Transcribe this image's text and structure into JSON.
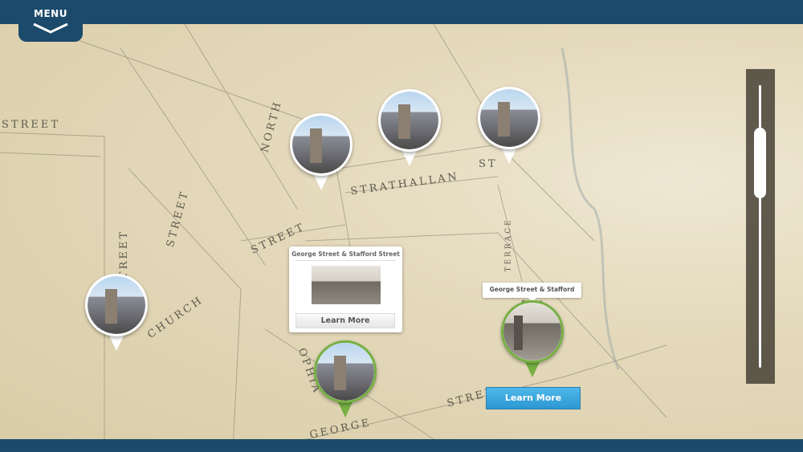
{
  "header": {
    "menu_label": "MENU"
  },
  "map": {
    "street_labels": [
      "STREET",
      "NORTH",
      "STRATHALLAN",
      "ST",
      "STREET",
      "STREET",
      "CHURCH",
      "STREET",
      "TERRACE",
      "OPHIA",
      "STREE",
      "GEORGE"
    ]
  },
  "popup": {
    "title": "George Street & Stafford Street",
    "learn_more": "Learn More"
  },
  "tooltip": {
    "title": "George Street & Stafford Street"
  },
  "active_pin": {
    "learn_more": "Learn More"
  },
  "zoom_slider": {
    "level": 0.2
  },
  "colors": {
    "bar": "#1b4a6b",
    "pin_active": "#76b043",
    "button": "#2c97d2"
  }
}
